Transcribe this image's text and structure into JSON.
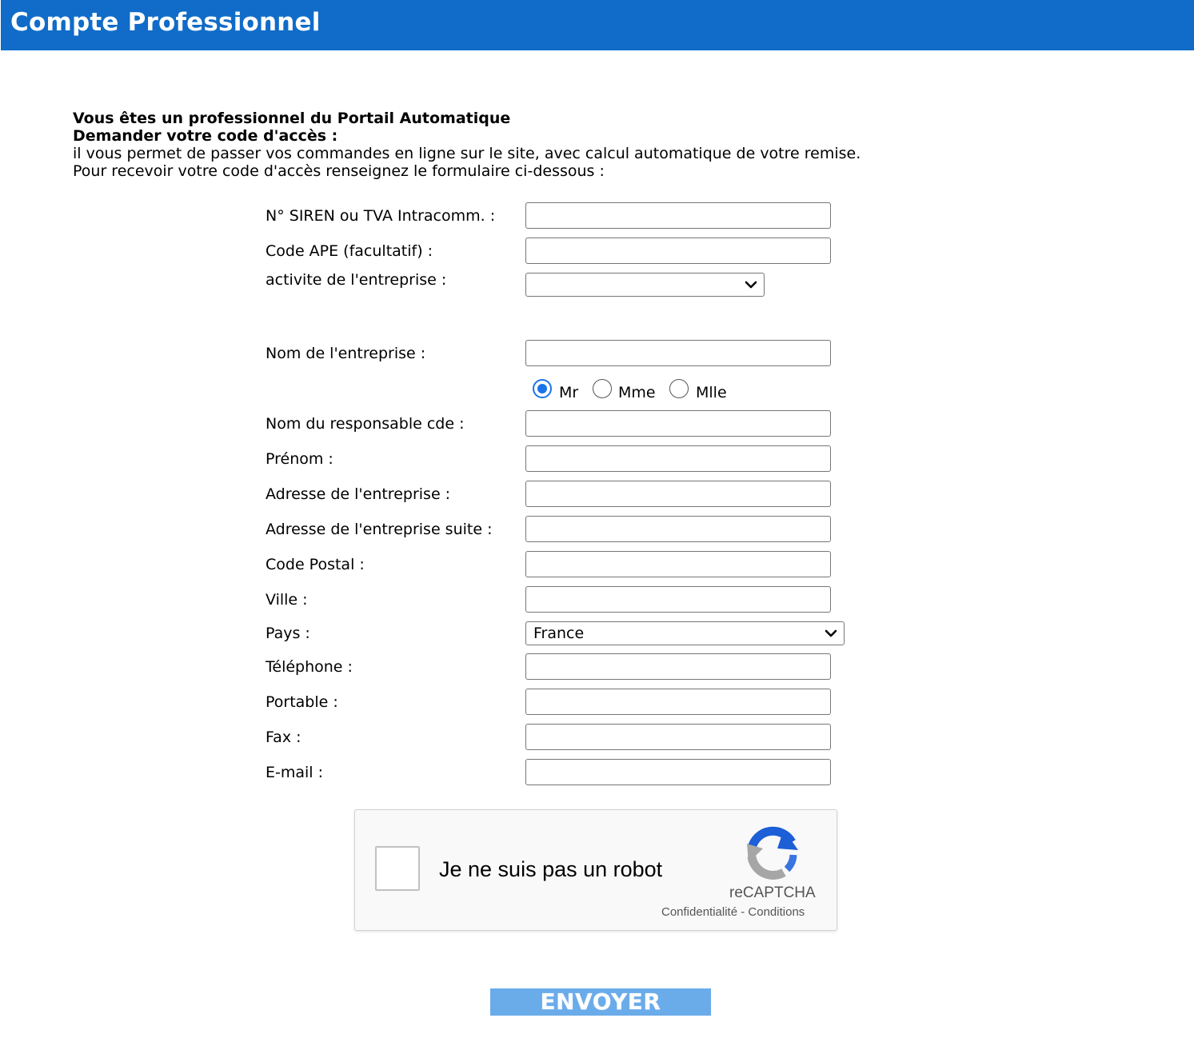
{
  "header": {
    "title": "Compte Professionnel",
    "color": "#106cc8"
  },
  "intro": {
    "line1": "Vous êtes un professionnel du Portail Automatique",
    "line2": "Demander votre code d'accès :",
    "line3": "il vous permet de passer vos commandes en ligne sur le site, avec calcul automatique de votre remise.",
    "line4": "Pour recevoir votre code d'accès renseignez le formulaire ci-dessous :"
  },
  "form": {
    "siren": {
      "label": "N° SIREN ou TVA Intracomm. :",
      "value": ""
    },
    "ape": {
      "label": "Code APE (facultatif) :",
      "value": ""
    },
    "activite": {
      "label": "activite de l'entreprise :",
      "selected": ""
    },
    "entreprise": {
      "label": "Nom de l'entreprise :",
      "value": ""
    },
    "civilite": {
      "options": [
        "Mr",
        "Mme",
        "Mlle"
      ],
      "selected": "Mr",
      "mr": "Mr",
      "mme": "Mme",
      "mlle": "Mlle"
    },
    "responsable": {
      "label": "Nom du responsable cde :",
      "value": ""
    },
    "prenom": {
      "label": "Prénom :",
      "value": ""
    },
    "adresse": {
      "label": "Adresse de l'entreprise :",
      "value": ""
    },
    "adresse_suite": {
      "label": "Adresse de l'entreprise suite :",
      "value": ""
    },
    "code_postal": {
      "label": "Code Postal :",
      "value": ""
    },
    "ville": {
      "label": "Ville :",
      "value": ""
    },
    "pays": {
      "label": "Pays :",
      "selected": "France"
    },
    "telephone": {
      "label": "Téléphone :",
      "value": ""
    },
    "portable": {
      "label": "Portable :",
      "value": ""
    },
    "fax": {
      "label": "Fax :",
      "value": ""
    },
    "email": {
      "label": "E-mail :",
      "value": ""
    }
  },
  "captcha": {
    "text": "Je ne suis pas un robot",
    "brand": "reCAPTCHA",
    "privacy": "Confidentialité",
    "separator": " - ",
    "terms": "Conditions",
    "checked": false
  },
  "submit": {
    "label": "ENVOYER",
    "color": "#6aabea"
  }
}
